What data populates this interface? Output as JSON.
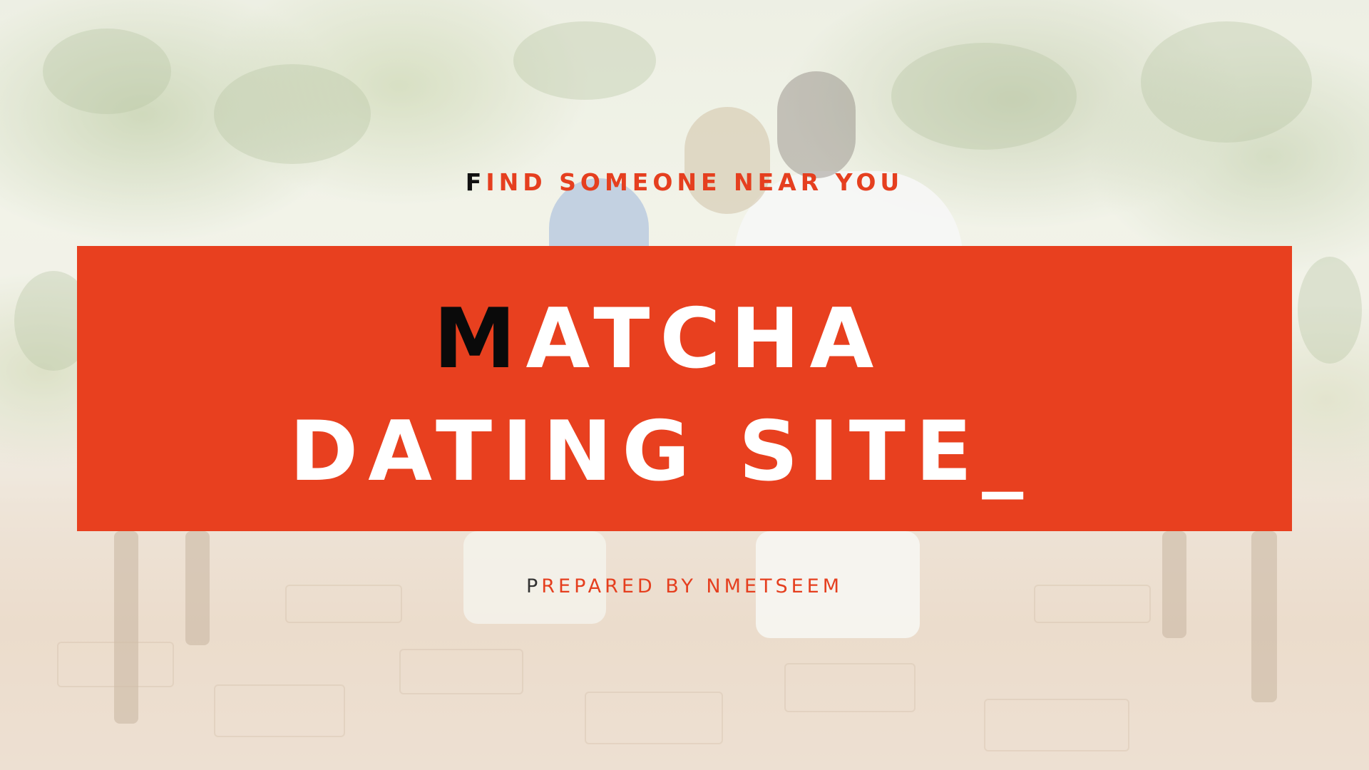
{
  "tagline": {
    "first_letter": "F",
    "rest": "IND SOMEONE NEAR YOU"
  },
  "title": {
    "line1_first": "M",
    "line1_rest": "ATCHA",
    "line2": "DATING SITE_"
  },
  "byline": {
    "first_letter": "P",
    "rest": "REPARED BY NMETSEEM"
  },
  "colors": {
    "accent": "#e8401f",
    "accent_text": "#e53f1f",
    "highlight_letter": "#0a0a0a",
    "title_text": "#ffffff"
  },
  "background": {
    "icon": "photo-couple-on-bench"
  }
}
